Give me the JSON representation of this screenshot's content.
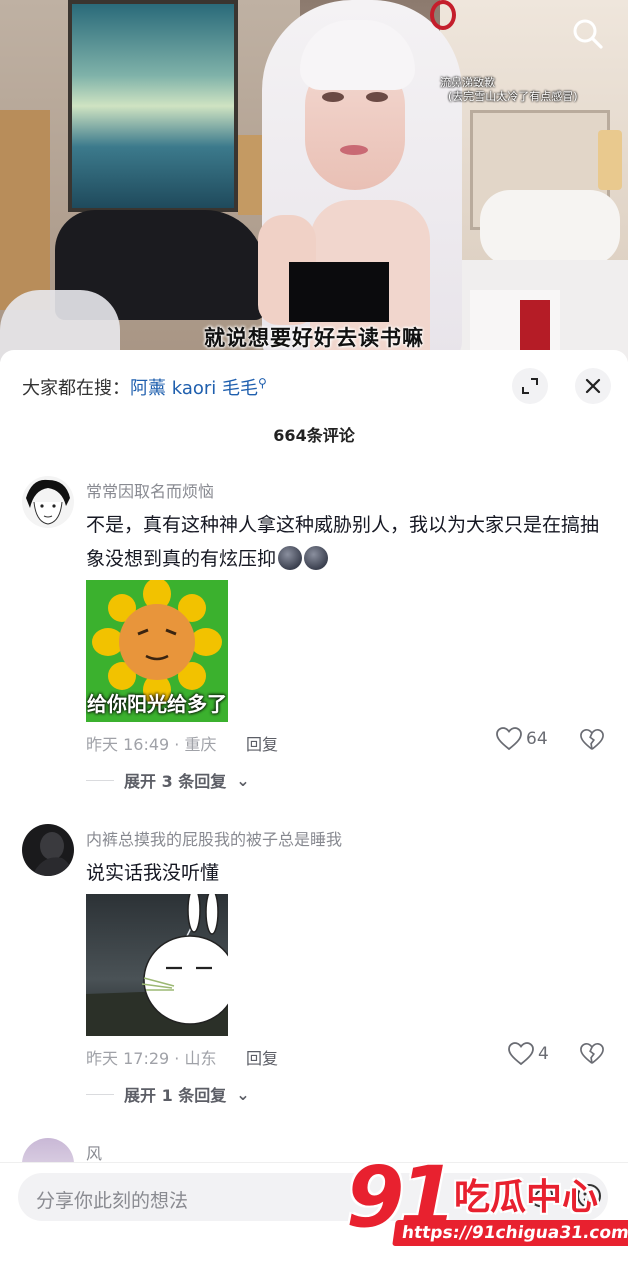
{
  "video": {
    "caption_line1": "流鼻涕致歉",
    "caption_line2": "(去完雪山太冷了有点感冒)",
    "subtitle": "就说想要好好去读书嘛"
  },
  "sheet": {
    "trend_prefix": "大家都在搜：",
    "trend_query": "阿薰 kaori 毛毛",
    "comment_count": "664条评论"
  },
  "comments": [
    {
      "username": "常常因取名而烦恼",
      "text": "不是，真有这种神人拿这种威胁别人，我以为大家只是在搞抽象没想到真的有炫压抑",
      "sticker_caption": "给你阳光给多了",
      "meta": "昨天 16:49 · 重庆",
      "reply_label": "回复",
      "likes": "64",
      "expand_label": "展开 3 条回复"
    },
    {
      "username": "内裤总摸我的屁股我的被子总是睡我",
      "text": "说实话我没听懂",
      "meta": "昨天 17:29 · 山东",
      "reply_label": "回复",
      "likes": "4",
      "expand_label": "展开 1 条回复"
    },
    {
      "username": "风"
    }
  ],
  "input": {
    "placeholder": "分享你此刻的想法"
  },
  "watermark": {
    "number": "91",
    "name": "吃瓜中心",
    "url": "https://91chigua31.com"
  },
  "colors": {
    "link_blue": "#1f5fae",
    "watermark_red": "#e8212f"
  }
}
